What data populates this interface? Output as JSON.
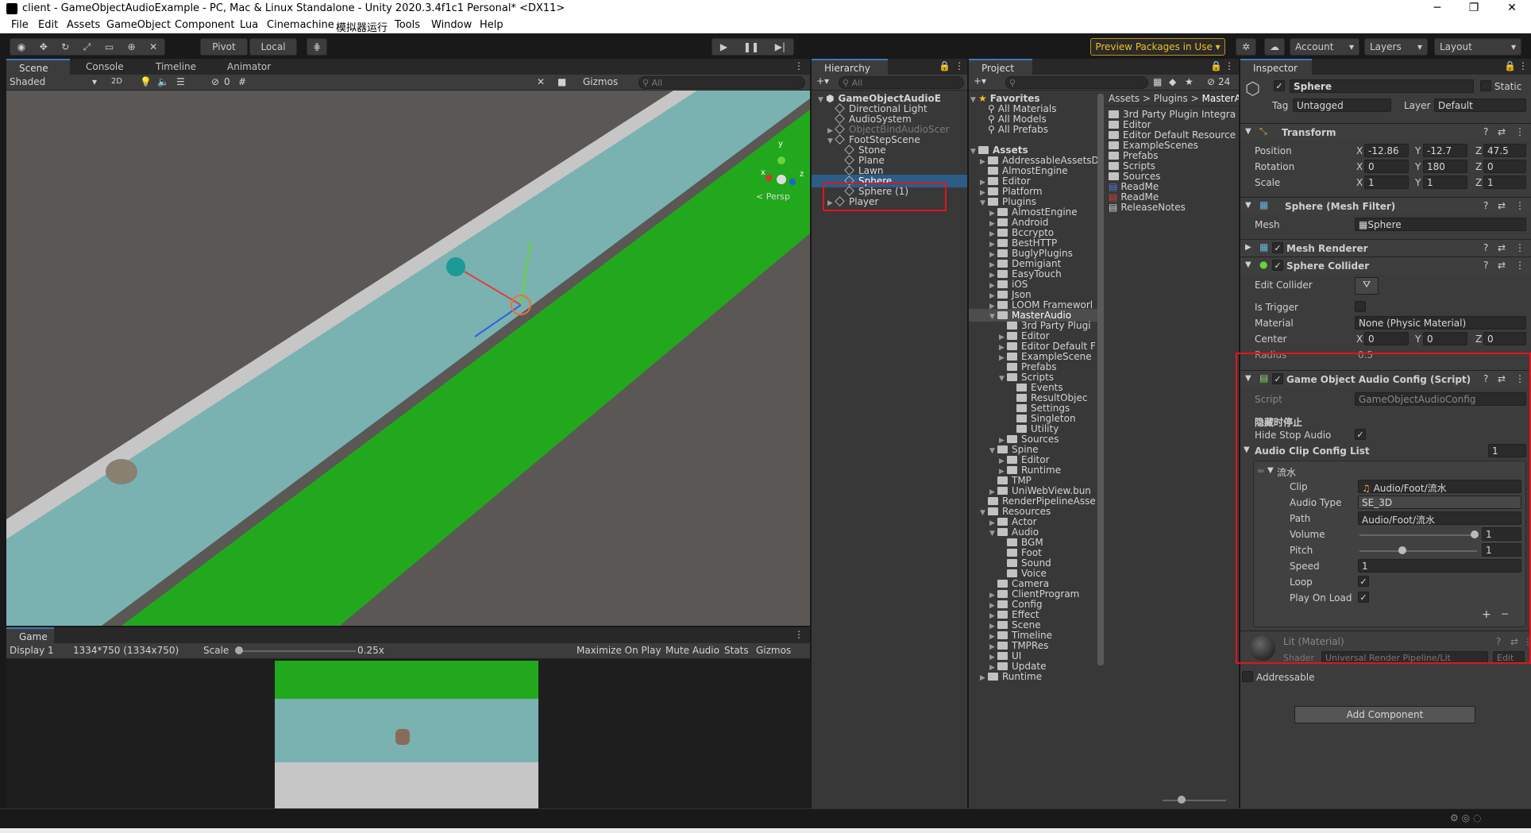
{
  "window": {
    "title": "client - GameObjectAudioExample - PC, Mac & Linux Standalone - Unity 2020.3.4f1c1 Personal* <DX11>",
    "minimize": "─",
    "maximize": "❐",
    "close": "✕"
  },
  "menu": [
    "File",
    "Edit",
    "Assets",
    "GameObject",
    "Component",
    "Lua",
    "Cinemachine",
    "模拟器运行",
    "Tools",
    "Window",
    "Help"
  ],
  "toolbar": {
    "pivot": "Pivot",
    "local": "Local",
    "preview": "Preview Packages in Use ▾",
    "account": "Account",
    "layers": "Layers",
    "layout": "Layout"
  },
  "scene": {
    "tabs": [
      "Scene",
      "Console",
      "Timeline",
      "Animator"
    ],
    "shading": "Shaded",
    "mode2d": "2D",
    "gizmos": "Gizmos",
    "search_placeholder": "All",
    "persp": "< Persp",
    "axis_y": "y",
    "axis_x": "x",
    "axis_z": "z",
    "hidden_count": "0"
  },
  "game": {
    "tab": "Game",
    "display": "Display 1",
    "resolution": "1334*750 (1334x750)",
    "scale_label": "Scale",
    "scale_value": "0.25x",
    "maximize": "Maximize On Play",
    "mute": "Mute Audio",
    "stats": "Stats",
    "gizmos": "Gizmos"
  },
  "hierarchy": {
    "tab": "Hierarchy",
    "search_placeholder": "All",
    "rows": [
      {
        "name": "GameObjectAudioE",
        "indent": 0,
        "arrow": "▼",
        "bold": true,
        "icon": "unity-icon"
      },
      {
        "name": "Directional Light",
        "indent": 1,
        "arrow": "",
        "icon": "cube-icon"
      },
      {
        "name": "AudioSystem",
        "indent": 1,
        "arrow": "",
        "icon": "cube-icon"
      },
      {
        "name": "ObjectBindAudioScer",
        "indent": 1,
        "arrow": "▶",
        "dim": true,
        "icon": "cube-icon"
      },
      {
        "name": "FootStepScene",
        "indent": 1,
        "arrow": "▼",
        "icon": "cube-icon"
      },
      {
        "name": "Stone",
        "indent": 2,
        "arrow": "",
        "icon": "cube-icon"
      },
      {
        "name": "Plane",
        "indent": 2,
        "arrow": "",
        "icon": "cube-icon"
      },
      {
        "name": "Lawn",
        "indent": 2,
        "arrow": "",
        "icon": "cube-icon"
      },
      {
        "name": "Sphere",
        "indent": 2,
        "arrow": "",
        "selected": true,
        "icon": "cube-icon"
      },
      {
        "name": "Sphere (1)",
        "indent": 2,
        "arrow": "",
        "icon": "cube-icon"
      },
      {
        "name": "Player",
        "indent": 1,
        "arrow": "▶",
        "icon": "cube-icon"
      }
    ]
  },
  "project": {
    "tab": "Project",
    "count": "24",
    "breadcrumb": [
      "Assets",
      ">",
      "Plugins",
      ">",
      "MasterA"
    ],
    "tree": [
      {
        "name": "Favorites",
        "indent": 0,
        "arrow": "▼",
        "icon": "star-icon",
        "bold": true
      },
      {
        "name": "All Materials",
        "indent": 1,
        "arrow": "",
        "icon": "search-icon"
      },
      {
        "name": "All Models",
        "indent": 1,
        "arrow": "",
        "icon": "search-icon"
      },
      {
        "name": "All Prefabs",
        "indent": 1,
        "arrow": "",
        "icon": "search-icon"
      },
      {
        "name": "",
        "indent": 0,
        "arrow": "",
        "icon": ""
      },
      {
        "name": "Assets",
        "indent": 0,
        "arrow": "▼",
        "icon": "folder-icon",
        "bold": true
      },
      {
        "name": "AddressableAssetsD",
        "indent": 1,
        "arrow": "▶",
        "icon": "folder-icon"
      },
      {
        "name": "AlmostEngine",
        "indent": 1,
        "arrow": "",
        "icon": "folder-icon"
      },
      {
        "name": "Editor",
        "indent": 1,
        "arrow": "▶",
        "icon": "folder-icon"
      },
      {
        "name": "Platform",
        "indent": 1,
        "arrow": "▶",
        "icon": "folder-icon"
      },
      {
        "name": "Plugins",
        "indent": 1,
        "arrow": "▼",
        "icon": "folder-icon"
      },
      {
        "name": "AlmostEngine",
        "indent": 2,
        "arrow": "▶",
        "icon": "folder-icon"
      },
      {
        "name": "Android",
        "indent": 2,
        "arrow": "▶",
        "icon": "folder-icon"
      },
      {
        "name": "Bccrypto",
        "indent": 2,
        "arrow": "▶",
        "icon": "folder-icon"
      },
      {
        "name": "BestHTTP",
        "indent": 2,
        "arrow": "▶",
        "icon": "folder-icon"
      },
      {
        "name": "BuglyPlugins",
        "indent": 2,
        "arrow": "▶",
        "icon": "folder-icon"
      },
      {
        "name": "Demigiant",
        "indent": 2,
        "arrow": "▶",
        "icon": "folder-icon"
      },
      {
        "name": "EasyTouch",
        "indent": 2,
        "arrow": "▶",
        "icon": "folder-icon"
      },
      {
        "name": "iOS",
        "indent": 2,
        "arrow": "▶",
        "icon": "folder-icon"
      },
      {
        "name": "Json",
        "indent": 2,
        "arrow": "▶",
        "icon": "folder-icon"
      },
      {
        "name": "LOOM Frameworl",
        "indent": 2,
        "arrow": "▶",
        "icon": "folder-icon"
      },
      {
        "name": "MasterAudio",
        "indent": 2,
        "arrow": "▼",
        "icon": "folder-icon",
        "selected": true
      },
      {
        "name": "3rd Party Plugi",
        "indent": 3,
        "arrow": "",
        "icon": "folder-icon"
      },
      {
        "name": "Editor",
        "indent": 3,
        "arrow": "▶",
        "icon": "folder-icon"
      },
      {
        "name": "Editor Default F",
        "indent": 3,
        "arrow": "▶",
        "icon": "folder-icon"
      },
      {
        "name": "ExampleScene",
        "indent": 3,
        "arrow": "▶",
        "icon": "folder-icon"
      },
      {
        "name": "Prefabs",
        "indent": 3,
        "arrow": "",
        "icon": "folder-icon"
      },
      {
        "name": "Scripts",
        "indent": 3,
        "arrow": "▼",
        "icon": "folder-icon"
      },
      {
        "name": "Events",
        "indent": 4,
        "arrow": "",
        "icon": "folder-icon"
      },
      {
        "name": "ResultObjec",
        "indent": 4,
        "arrow": "",
        "icon": "folder-icon"
      },
      {
        "name": "Settings",
        "indent": 4,
        "arrow": "",
        "icon": "folder-icon"
      },
      {
        "name": "Singleton",
        "indent": 4,
        "arrow": "",
        "icon": "folder-icon"
      },
      {
        "name": "Utility",
        "indent": 4,
        "arrow": "",
        "icon": "folder-icon"
      },
      {
        "name": "Sources",
        "indent": 3,
        "arrow": "▶",
        "icon": "folder-icon"
      },
      {
        "name": "Spine",
        "indent": 2,
        "arrow": "▼",
        "icon": "folder-icon"
      },
      {
        "name": "Editor",
        "indent": 3,
        "arrow": "▶",
        "icon": "folder-icon"
      },
      {
        "name": "Runtime",
        "indent": 3,
        "arrow": "▶",
        "icon": "folder-icon"
      },
      {
        "name": "TMP",
        "indent": 2,
        "arrow": "",
        "icon": "folder-icon"
      },
      {
        "name": "UniWebView.bun",
        "indent": 2,
        "arrow": "▶",
        "icon": "folder-icon"
      },
      {
        "name": "RenderPipelineAsse",
        "indent": 1,
        "arrow": "",
        "icon": "folder-icon"
      },
      {
        "name": "Resources",
        "indent": 1,
        "arrow": "▼",
        "icon": "folder-icon"
      },
      {
        "name": "Actor",
        "indent": 2,
        "arrow": "▶",
        "icon": "folder-icon"
      },
      {
        "name": "Audio",
        "indent": 2,
        "arrow": "▼",
        "icon": "folder-icon"
      },
      {
        "name": "BGM",
        "indent": 3,
        "arrow": "",
        "icon": "folder-icon"
      },
      {
        "name": "Foot",
        "indent": 3,
        "arrow": "",
        "icon": "folder-icon"
      },
      {
        "name": "Sound",
        "indent": 3,
        "arrow": "",
        "icon": "folder-icon"
      },
      {
        "name": "Voice",
        "indent": 3,
        "arrow": "",
        "icon": "folder-icon"
      },
      {
        "name": "Camera",
        "indent": 2,
        "arrow": "",
        "icon": "folder-icon"
      },
      {
        "name": "ClientProgram",
        "indent": 2,
        "arrow": "▶",
        "icon": "folder-icon"
      },
      {
        "name": "Config",
        "indent": 2,
        "arrow": "▶",
        "icon": "folder-icon"
      },
      {
        "name": "Effect",
        "indent": 2,
        "arrow": "▶",
        "icon": "folder-icon"
      },
      {
        "name": "Scene",
        "indent": 2,
        "arrow": "▶",
        "icon": "folder-icon"
      },
      {
        "name": "Timeline",
        "indent": 2,
        "arrow": "▶",
        "icon": "folder-icon"
      },
      {
        "name": "TMPRes",
        "indent": 2,
        "arrow": "▶",
        "icon": "folder-icon"
      },
      {
        "name": "UI",
        "indent": 2,
        "arrow": "▶",
        "icon": "folder-icon"
      },
      {
        "name": "Update",
        "indent": 2,
        "arrow": "▶",
        "icon": "folder-icon"
      },
      {
        "name": "Runtime",
        "indent": 1,
        "arrow": "▶",
        "icon": "folder-icon"
      }
    ],
    "files": [
      {
        "name": "3rd Party Plugin Integra",
        "icon": "folder-icon"
      },
      {
        "name": "Editor",
        "icon": "folder-icon"
      },
      {
        "name": "Editor Default Resource",
        "icon": "folder-icon"
      },
      {
        "name": "ExampleScenes",
        "icon": "folder-icon"
      },
      {
        "name": "Prefabs",
        "icon": "folder-icon"
      },
      {
        "name": "Scripts",
        "icon": "folder-icon"
      },
      {
        "name": "Sources",
        "icon": "folder-icon"
      },
      {
        "name": "ReadMe",
        "icon": "word-doc-icon"
      },
      {
        "name": "ReadMe",
        "icon": "pdf-icon"
      },
      {
        "name": "ReleaseNotes",
        "icon": "text-file-icon"
      }
    ]
  },
  "inspector": {
    "tab": "Inspector",
    "object_name": "Sphere",
    "static": "Static",
    "tag_label": "Tag",
    "tag": "Untagged",
    "layer_label": "Layer",
    "layer": "Default",
    "transform": {
      "title": "Transform",
      "position": {
        "label": "Position",
        "x": "-12.86",
        "y": "-12.7",
        "z": "47.5"
      },
      "rotation": {
        "label": "Rotation",
        "x": "0",
        "y": "180",
        "z": "0"
      },
      "scale": {
        "label": "Scale",
        "x": "1",
        "y": "1",
        "z": "1"
      }
    },
    "mesh_filter": {
      "title": "Sphere (Mesh Filter)",
      "mesh_label": "Mesh",
      "mesh": "Sphere"
    },
    "mesh_renderer": {
      "title": "Mesh Renderer"
    },
    "collider": {
      "title": "Sphere Collider",
      "edit": "Edit Collider",
      "trigger": "Is Trigger",
      "material_label": "Material",
      "material": "None (Physic Material)",
      "center_label": "Center",
      "cx": "0",
      "cy": "0",
      "cz": "0",
      "radius_label": "Radius",
      "radius": "0.5"
    },
    "script": {
      "title": "Game Object Audio Config (Script)",
      "script_label": "Script",
      "script": "GameObjectAudioConfig",
      "header": "隐藏时停止",
      "hide_stop": "Hide Stop Audio",
      "list_label": "Audio Clip Config List",
      "list_count": "1",
      "element": "流水",
      "clip_label": "Clip",
      "clip": "Audio/Foot/流水",
      "type_label": "Audio Type",
      "type": "SE_3D",
      "path_label": "Path",
      "path": "Audio/Foot/流水",
      "volume_label": "Volume",
      "volume": "1",
      "volume_fraction": 1,
      "pitch_label": "Pitch",
      "pitch": "1",
      "pitch_fraction": 0.35,
      "speed_label": "Speed",
      "speed": "1",
      "loop_label": "Loop",
      "load_label": "Play On Load"
    },
    "material": {
      "title": "Lit (Material)",
      "shader_label": "Shader",
      "shader": "Universal Render Pipeline/Lit",
      "edit": "Edit"
    },
    "addressable": "Addressable",
    "add_component": "Add Component"
  },
  "colors": {
    "accent": "#3a79bb",
    "selection": "#2c5d87",
    "highlight": "#e2141c",
    "grass": "#22a81c",
    "water": "#79b2b1",
    "floor": "#5a5755"
  }
}
